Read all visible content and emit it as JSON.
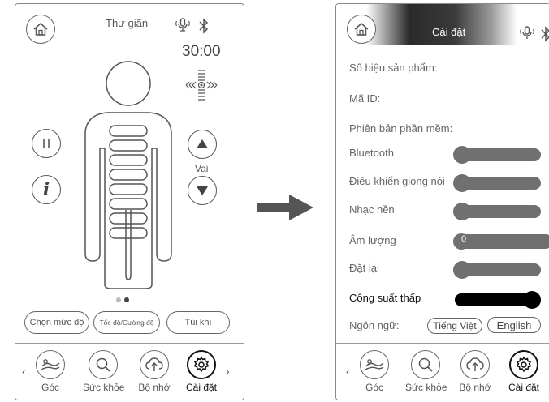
{
  "left_screen": {
    "title": "Thư giãn",
    "timer": "30:00",
    "side_label": "Vai",
    "buttons": {
      "level": "Chọn mức độ",
      "speed": "Tốc độ/Cường độ",
      "airbag": "Túi khí"
    },
    "page_dots": 2,
    "active_page": 2
  },
  "right_screen": {
    "title": "Cài đặt",
    "product_no_label": "Số hiệu sản phẩm:",
    "id_label": "Mã ID:",
    "software_label": "Phiên bản phần mềm:",
    "settings": [
      {
        "label": "Bluetooth",
        "state": "off"
      },
      {
        "label": "Điều khiển giọng nói",
        "state": "off"
      },
      {
        "label": "Nhạc nền",
        "state": "off"
      },
      {
        "label": "Âm lượng",
        "state": "off",
        "value": "0"
      },
      {
        "label": "Đặt lại",
        "state": "off"
      },
      {
        "label": "Công suất thấp",
        "state": "on"
      }
    ],
    "language_label": "Ngôn ngữ:",
    "languages": [
      "Tiếng Việt",
      "English"
    ]
  },
  "nav": {
    "items": [
      {
        "label": "Góc",
        "icon": "recline-icon"
      },
      {
        "label": "Sức khỏe",
        "icon": "search-icon"
      },
      {
        "label": "Bộ nhớ",
        "icon": "cloud-upload-icon"
      },
      {
        "label": "Cài đặt",
        "icon": "gear-icon"
      }
    ],
    "active": "Cài đặt",
    "prev": "‹",
    "next": "›"
  },
  "colors": {
    "accent": "#000000",
    "toggle_off": "#707070",
    "border": "#888888"
  }
}
